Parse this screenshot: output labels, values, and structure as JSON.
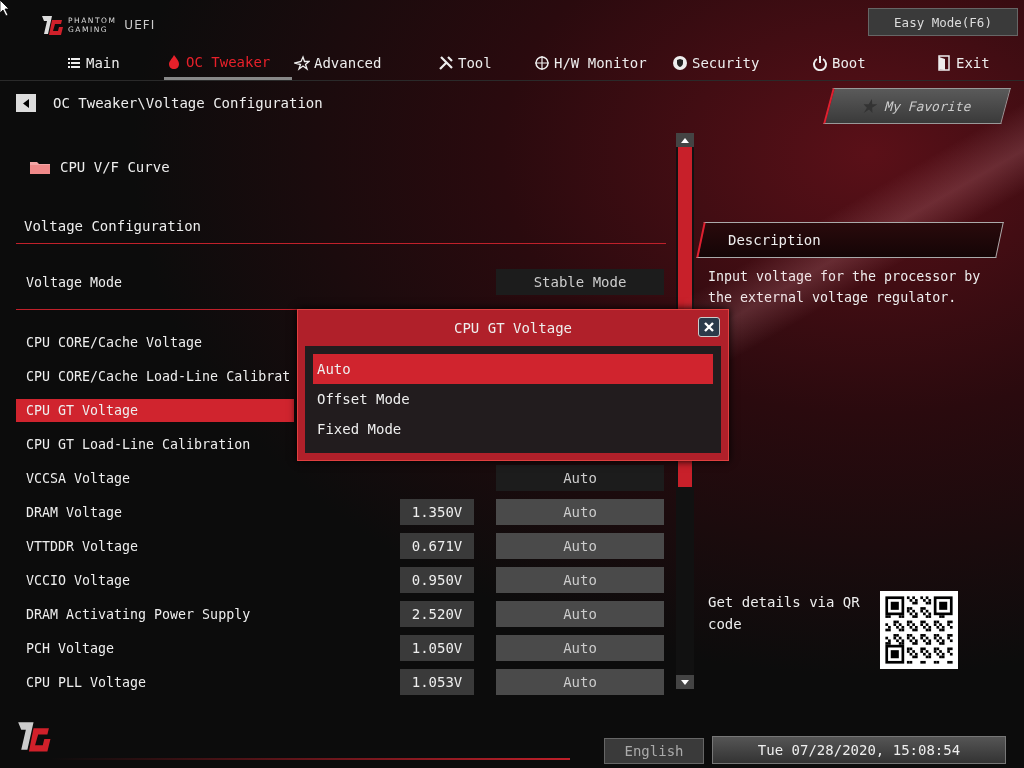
{
  "header": {
    "brand_lines": [
      "PHANTOM",
      "GAMING"
    ],
    "product": "UEFI",
    "easy_mode_button": "Easy Mode(F6)"
  },
  "tabs": [
    {
      "label": "Main",
      "kind": "list",
      "selected": false
    },
    {
      "label": "OC Tweaker",
      "kind": "flame",
      "selected": true
    },
    {
      "label": "Advanced",
      "kind": "star",
      "selected": false
    },
    {
      "label": "Tool",
      "kind": "tools",
      "selected": false
    },
    {
      "label": "H/W Monitor",
      "kind": "target",
      "selected": false
    },
    {
      "label": "Security",
      "kind": "shield",
      "selected": false
    },
    {
      "label": "Boot",
      "kind": "power",
      "selected": false
    },
    {
      "label": "Exit",
      "kind": "door",
      "selected": false
    }
  ],
  "breadcrumb": "OC Tweaker\\Voltage Configuration",
  "favorite_button": "My Favorite",
  "folder_item": "CPU V/F Curve",
  "section_title": "Voltage Configuration",
  "voltage_mode": {
    "label": "Voltage Mode",
    "value": "Stable Mode"
  },
  "settings": [
    {
      "label": "CPU CORE/Cache Voltage",
      "selected": false
    },
    {
      "label": "CPU CORE/Cache Load-Line Calibrat",
      "selected": false
    },
    {
      "label": "CPU GT Voltage",
      "selected": true
    },
    {
      "label": "CPU GT Load-Line Calibration",
      "selected": false
    },
    {
      "label": "VCCSA Voltage",
      "value": "Auto",
      "selected": false
    },
    {
      "label": "DRAM Voltage",
      "reading": "1.350V",
      "value": "Auto",
      "selected": false
    },
    {
      "label": "VTTDDR Voltage",
      "reading": "0.671V",
      "value": "Auto",
      "selected": false
    },
    {
      "label": "VCCIO Voltage",
      "reading": "0.950V",
      "value": "Auto",
      "selected": false
    },
    {
      "label": "DRAM Activating Power Supply",
      "reading": "2.520V",
      "value": "Auto",
      "selected": false
    },
    {
      "label": "PCH Voltage",
      "reading": "1.050V",
      "value": "Auto",
      "selected": false
    },
    {
      "label": "CPU PLL Voltage",
      "reading": "1.053V",
      "value": "Auto",
      "selected": false
    }
  ],
  "description": {
    "title": "Description",
    "text": "Input voltage for the processor by the external voltage regulator."
  },
  "qr_text": "Get details via QR code",
  "popup": {
    "title": "CPU GT Voltage",
    "options": [
      {
        "label": "Auto",
        "selected": true
      },
      {
        "label": "Offset Mode",
        "selected": false
      },
      {
        "label": "Fixed Mode",
        "selected": false
      }
    ]
  },
  "footer": {
    "language": "English",
    "datetime": "Tue 07/28/2020, 15:08:54"
  }
}
